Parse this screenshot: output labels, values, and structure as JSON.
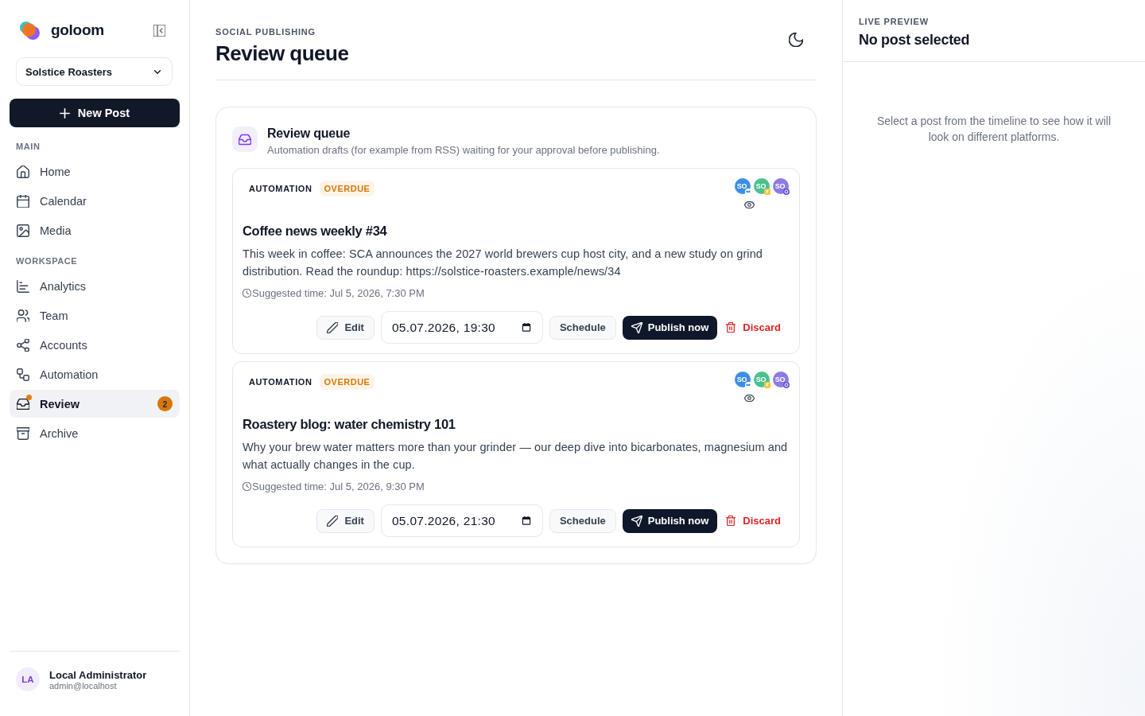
{
  "sidebar": {
    "brand": "goloom",
    "organization": "Solstice Roasters",
    "new_post": "New Post",
    "sections": [
      {
        "label": "MAIN",
        "items": [
          {
            "label": "Home",
            "selected": false,
            "unread": false
          },
          {
            "label": "Calendar",
            "selected": false,
            "unread": false
          },
          {
            "label": "Media",
            "selected": false,
            "unread": false
          }
        ]
      },
      {
        "label": "WORKSPACE",
        "items": [
          {
            "label": "Analytics",
            "selected": false,
            "unread": false
          },
          {
            "label": "Team",
            "selected": false,
            "unread": false
          },
          {
            "label": "Accounts",
            "selected": false,
            "unread": false
          },
          {
            "label": "Automation",
            "selected": false,
            "unread": false
          },
          {
            "label": "Review",
            "selected": true,
            "unread": true,
            "badge": "2"
          },
          {
            "label": "Archive",
            "selected": false,
            "unread": false
          }
        ]
      }
    ],
    "user": {
      "initials": "LA",
      "name": "Local Administrator",
      "email": "admin@localhost"
    }
  },
  "header": {
    "eyebrow": "SOCIAL PUBLISHING",
    "title": "Review queue"
  },
  "queue": {
    "title": "Review queue",
    "description": "Automation drafts (for example from RSS) waiting for your approval before publishing.",
    "posts": [
      {
        "source": "AUTOMATION",
        "status": "OVERDUE",
        "accounts": [
          {
            "initials": "SO",
            "color": "#3b8ee8",
            "kind": "butterfly"
          },
          {
            "initials": "SO",
            "color": "#4cc28e",
            "kind": "square"
          },
          {
            "initials": "SO",
            "color": "#8b7be6",
            "kind": "ring"
          }
        ],
        "title": "Coffee news weekly #34",
        "body": "This week in coffee: SCA announces the 2027 world brewers cup host city, and a new study on grind distribution. Read the roundup: https://solstice-roasters.example/news/34",
        "suggested": "Suggested time: Jul 5, 2026, 7:30 PM",
        "actions": [
          {
            "kind": "edit",
            "label": "Edit"
          },
          {
            "kind": "datetime",
            "value": "05.07.2026, 19:30"
          },
          {
            "kind": "schedule",
            "label": "Schedule"
          },
          {
            "kind": "publish",
            "label": "Publish now"
          },
          {
            "kind": "discard",
            "label": "Discard"
          }
        ]
      },
      {
        "source": "AUTOMATION",
        "status": "OVERDUE",
        "accounts": [
          {
            "initials": "SO",
            "color": "#3b8ee8",
            "kind": "butterfly"
          },
          {
            "initials": "SO",
            "color": "#4cc28e",
            "kind": "square"
          },
          {
            "initials": "SO",
            "color": "#8b7be6",
            "kind": "ring"
          }
        ],
        "title": "Roastery blog: water chemistry 101",
        "body": "Why your brew water matters more than your grinder — our deep dive into bicarbonates, magnesium and what actually changes in the cup.",
        "suggested": "Suggested time: Jul 5, 2026, 9:30 PM",
        "actions": [
          {
            "kind": "edit",
            "label": "Edit"
          },
          {
            "kind": "datetime",
            "value": "05.07.2026, 21:30"
          },
          {
            "kind": "schedule",
            "label": "Schedule"
          },
          {
            "kind": "publish",
            "label": "Publish now"
          },
          {
            "kind": "discard",
            "label": "Discard"
          }
        ]
      }
    ]
  },
  "preview": {
    "eyebrow": "LIVE PREVIEW",
    "title": "No post selected",
    "message": "Select a post from the timeline to see how it will look on different platforms."
  }
}
